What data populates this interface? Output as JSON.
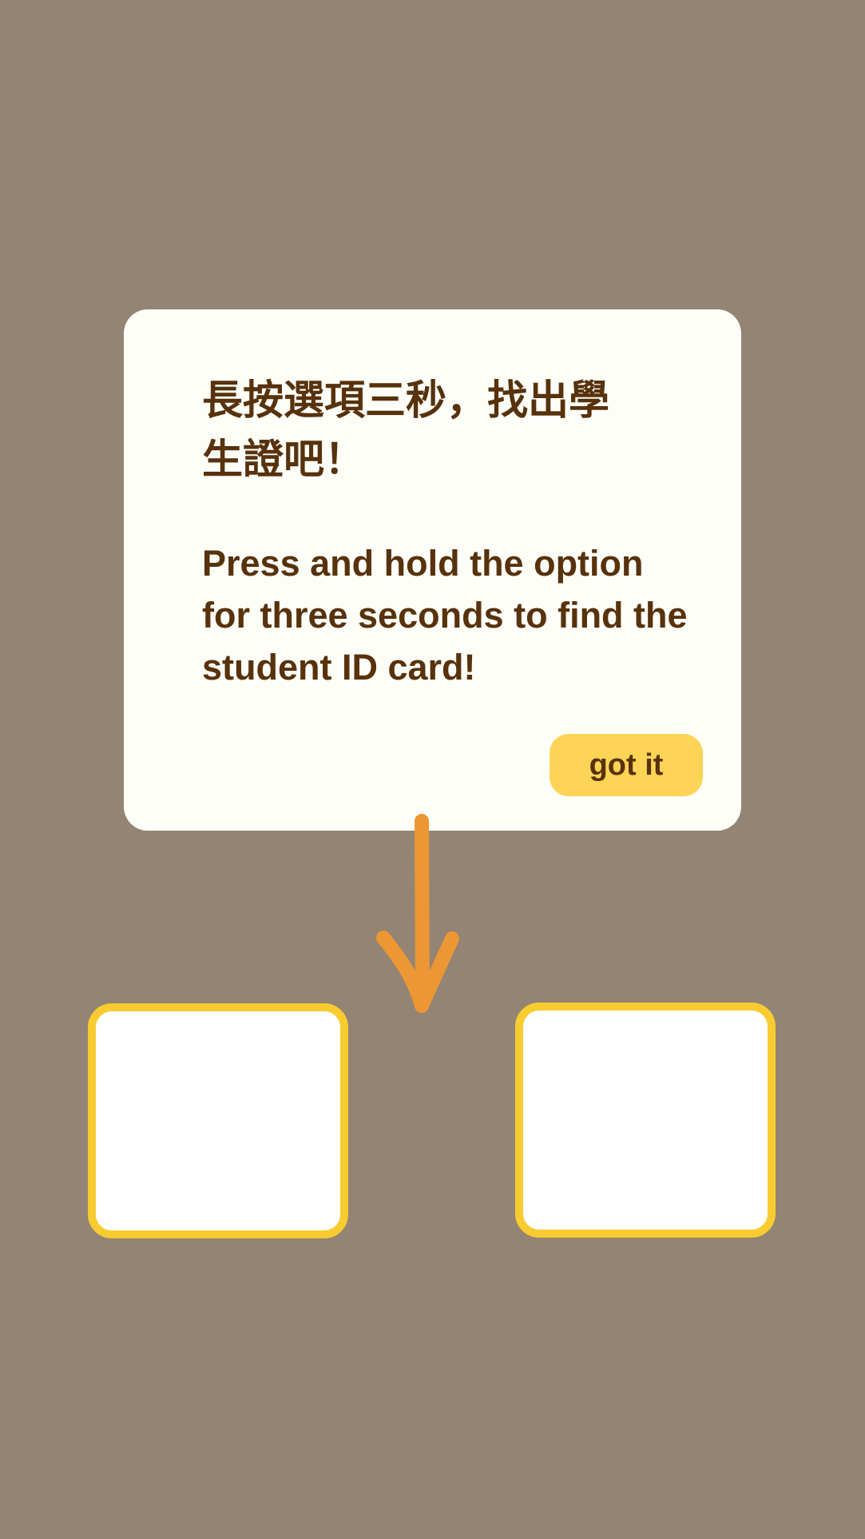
{
  "tutorial": {
    "title_zh": "長按選項三秒，找出學生證吧！",
    "title_en": "Press and hold the option for three seconds to find the student ID card!",
    "confirm_label": "got it"
  },
  "pointer": {
    "icon": "arrow-down-icon",
    "color": "#ec9733"
  },
  "options": {
    "count": 2,
    "border_color": "#f8cc30"
  },
  "colors": {
    "backdrop": "#948473",
    "card": "#fefef8",
    "text": "#57320c",
    "button": "#fdd455"
  }
}
